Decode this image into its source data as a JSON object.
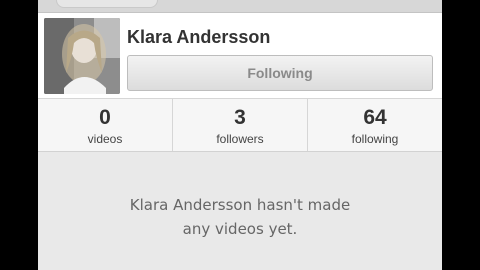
{
  "profile": {
    "name": "Klara Andersson",
    "follow_button_label": "Following"
  },
  "stats": [
    {
      "value": "0",
      "label": "videos"
    },
    {
      "value": "3",
      "label": "followers"
    },
    {
      "value": "64",
      "label": "following"
    }
  ],
  "empty_state": {
    "line1": "Klara Andersson hasn't made",
    "line2": "any videos yet."
  },
  "colors": {
    "page_background": "#e9e9e9",
    "profile_background": "#ffffff",
    "button_text": "#8a8a8a"
  }
}
